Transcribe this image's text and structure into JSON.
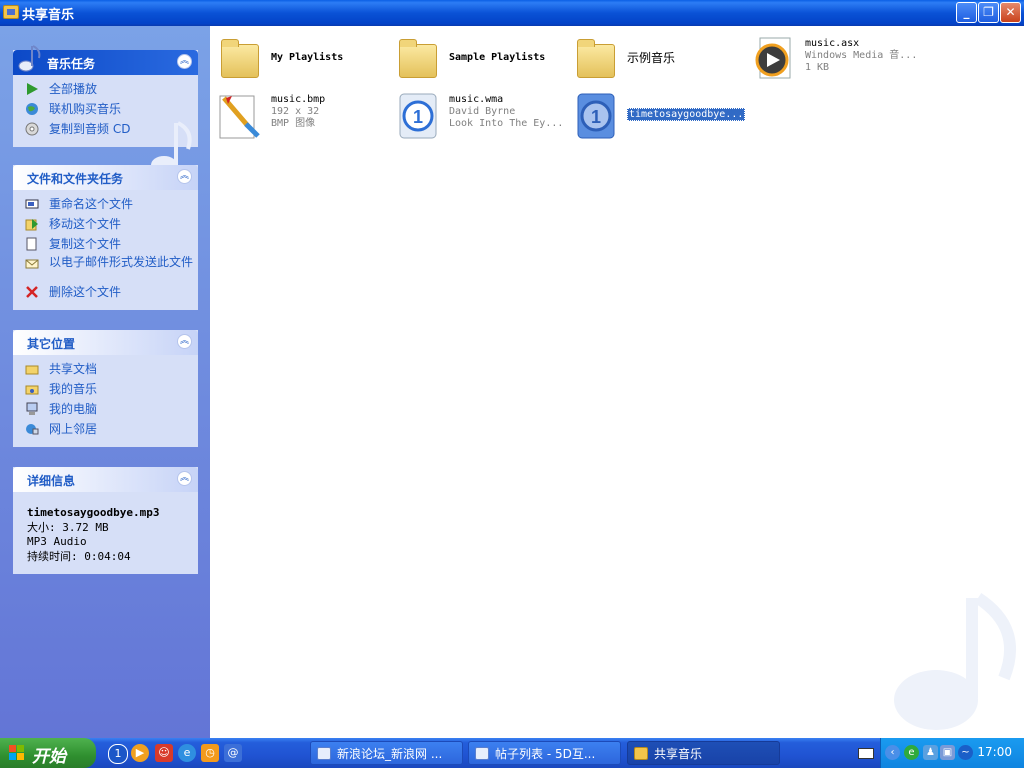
{
  "window": {
    "title": "共享音乐",
    "controls": [
      "minimize-button",
      "restore-button",
      "close-button"
    ]
  },
  "sidebar": {
    "music_tasks": {
      "title": "音乐任务",
      "items": [
        {
          "label": "全部播放",
          "icon": "play-icon"
        },
        {
          "label": "联机购买音乐",
          "icon": "globe-icon"
        },
        {
          "label": "复制到音频 CD",
          "icon": "cd-icon"
        }
      ]
    },
    "file_tasks": {
      "title": "文件和文件夹任务",
      "items": [
        {
          "label": "重命名这个文件",
          "icon": "rename-icon"
        },
        {
          "label": "移动这个文件",
          "icon": "move-icon"
        },
        {
          "label": "复制这个文件",
          "icon": "copy-icon"
        },
        {
          "label": "以电子邮件形式发送此文件",
          "icon": "email-icon"
        },
        {
          "label": "删除这个文件",
          "icon": "delete-icon"
        }
      ]
    },
    "other_places": {
      "title": "其它位置",
      "items": [
        {
          "label": "共享文档",
          "icon": "folder-icon"
        },
        {
          "label": "我的音乐",
          "icon": "music-folder-icon"
        },
        {
          "label": "我的电脑",
          "icon": "computer-icon"
        },
        {
          "label": "网上邻居",
          "icon": "network-icon"
        }
      ]
    },
    "details": {
      "title": "详细信息",
      "filename": "timetosaygoodbye.mp3",
      "size": "大小: 3.72 MB",
      "type": "MP3 Audio",
      "duration": "持续时间: 0:04:04"
    }
  },
  "files": [
    {
      "name": "My Playlists",
      "kind": "folder"
    },
    {
      "name": "Sample Playlists",
      "kind": "folder"
    },
    {
      "name": "示例音乐",
      "kind": "folder"
    },
    {
      "name": "music.asx",
      "line2": "Windows Media 音...",
      "line3": "1 KB",
      "kind": "asx"
    },
    {
      "name": "music.bmp",
      "line2": "192 x 32",
      "line3": "BMP 图像",
      "kind": "bmp"
    },
    {
      "name": "music.wma",
      "line2": "David Byrne",
      "line3": "Look Into The Ey...",
      "kind": "wma"
    },
    {
      "name": "timetosaygoodbye...",
      "kind": "mp3",
      "selected": true
    }
  ],
  "taskbar": {
    "start_label": "开始",
    "tasks": [
      {
        "label": "新浪论坛_新浪网 ..."
      },
      {
        "label": "帖子列表 - 5D互..."
      },
      {
        "label": "共享音乐",
        "active": true
      }
    ],
    "clock": "17:00"
  },
  "colors": {
    "title_bar": "#0a52d6",
    "sidebar_gradient_top": "#7ba2e7",
    "sidebar_gradient_bottom": "#6375d6",
    "link": "#215dc6",
    "selection": "#316ac5",
    "start_green": "#3a9a3a"
  }
}
